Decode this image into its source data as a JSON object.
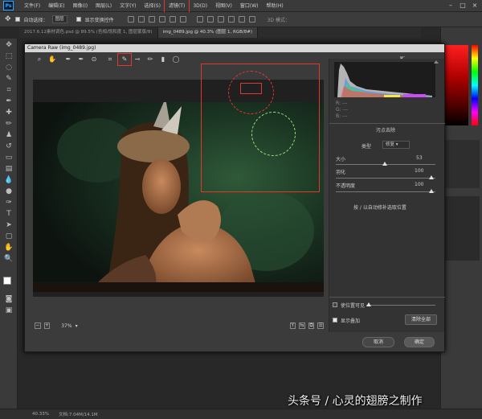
{
  "app": {
    "logo": "Ps"
  },
  "menu": [
    "文件(F)",
    "编辑(E)",
    "图像(I)",
    "图层(L)",
    "文字(Y)",
    "选择(S)",
    "滤镜(T)",
    "3D(D)",
    "视图(V)",
    "窗口(W)",
    "帮助(H)"
  ],
  "highlighted_menu": "滤镜(T)",
  "options": {
    "auto_select_label": "自动选择：",
    "auto_select_value": "图层",
    "show_transform": "显示变换控件",
    "mode3d": "3D 模式："
  },
  "tabs": [
    {
      "label": "2017.6.12素材调色.psd @ 89.5% (色相/饱和度 1, 图层蒙版/8)",
      "active": false
    },
    {
      "label": "img_0489.jpg @ 40.3% (图层 1, RGB/8#)",
      "active": true
    }
  ],
  "camera_raw": {
    "title": "Camera Raw (img_0489.jpg)",
    "tools": [
      "zoom-icon",
      "hand-icon",
      "white-balance-icon",
      "color-sampler-icon",
      "targeted-adjust-icon",
      "crop-icon",
      "straighten-icon",
      "spot-removal-icon",
      "red-eye-icon",
      "adjustment-brush-icon",
      "graduated-filter-icon",
      "radial-filter-icon"
    ],
    "active_tool": "spot-removal-icon",
    "rgb": {
      "r": "R: ---",
      "g": "G: ---",
      "b": "B: ---"
    },
    "panel_title": "污点去除",
    "type_label": "类型",
    "type_value": "修复",
    "size_label": "大小",
    "size_value": "53",
    "feather_label": "羽化",
    "feather_value": "100",
    "opacity_label": "不透明度",
    "opacity_value": "100",
    "hint": "按 / 以自动修补选取位置",
    "visualize_label": "使位置可见",
    "overlay_label": "显示叠加",
    "clear_all": "清除全部",
    "zoom_value": "37%",
    "cancel": "取消",
    "ok": "确定"
  },
  "status": {
    "zoom": "40.33%",
    "doc": "文档:7.04M/14.1M"
  },
  "watermark": "头条号 / 心灵的翅膀之制作",
  "colors": {
    "accent_red": "#e2372b",
    "bg": "#282828"
  }
}
